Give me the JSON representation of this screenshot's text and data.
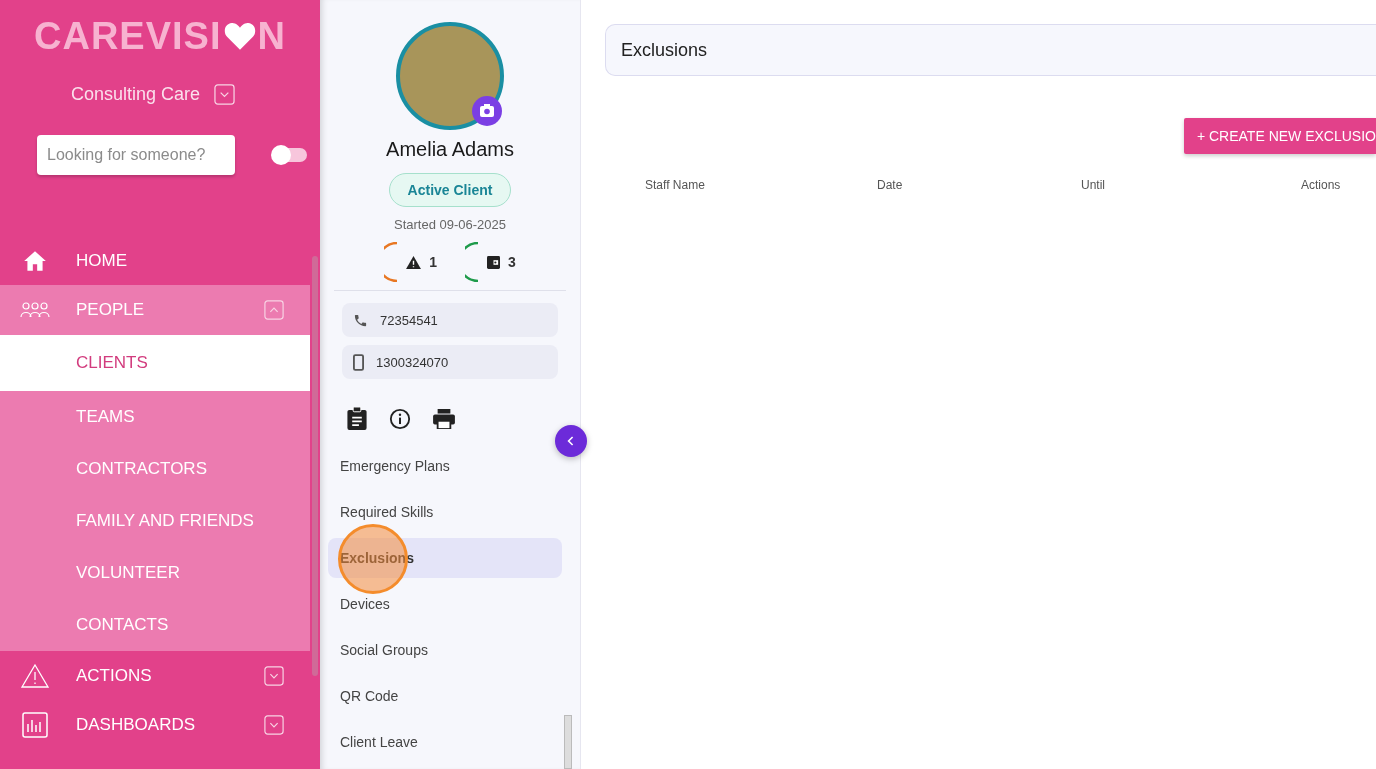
{
  "brand": {
    "logo_start": "CAREVISI",
    "logo_end": "N"
  },
  "organization": {
    "name": "Consulting Care"
  },
  "search": {
    "placeholder": "Looking for someone?",
    "toggle_on": false
  },
  "nav": [
    {
      "label": "HOME",
      "kind": "home"
    },
    {
      "label": "PEOPLE",
      "kind": "people",
      "expanded": true,
      "children": [
        {
          "label": "CLIENTS",
          "selected": true
        },
        {
          "label": "TEAMS",
          "selected": false
        },
        {
          "label": "CONTRACTORS",
          "selected": false
        },
        {
          "label": "FAMILY AND FRIENDS",
          "selected": false
        },
        {
          "label": "VOLUNTEER",
          "selected": false
        },
        {
          "label": "CONTACTS",
          "selected": false
        }
      ]
    },
    {
      "label": "ACTIONS",
      "kind": "warning",
      "expanded": false
    },
    {
      "label": "DASHBOARDS",
      "kind": "chart",
      "expanded": false
    }
  ],
  "client": {
    "name": "Amelia Adams",
    "status": "Active Client",
    "started": "Started 09-06-2025",
    "indicators": [
      {
        "kind": "alert",
        "count": "1",
        "color": "#e87722"
      },
      {
        "kind": "wallet",
        "count": "3",
        "color": "#1e9a4a"
      }
    ],
    "contacts": [
      {
        "kind": "phone",
        "value": "72354541"
      },
      {
        "kind": "mobile",
        "value": "1300324070"
      }
    ]
  },
  "client_menu": [
    {
      "label": "Emergency Plans",
      "selected": false
    },
    {
      "label": "Required Skills",
      "selected": false
    },
    {
      "label": "Exclusions",
      "selected": true
    },
    {
      "label": "Devices",
      "selected": false
    },
    {
      "label": "Social Groups",
      "selected": false
    },
    {
      "label": "QR Code",
      "selected": false
    },
    {
      "label": "Client Leave",
      "selected": false
    }
  ],
  "page": {
    "title": "Exclusions",
    "create_button": "+ CREATE NEW EXCLUSIO",
    "columns": [
      "Staff Name",
      "Date",
      "Until",
      "Actions"
    ]
  }
}
